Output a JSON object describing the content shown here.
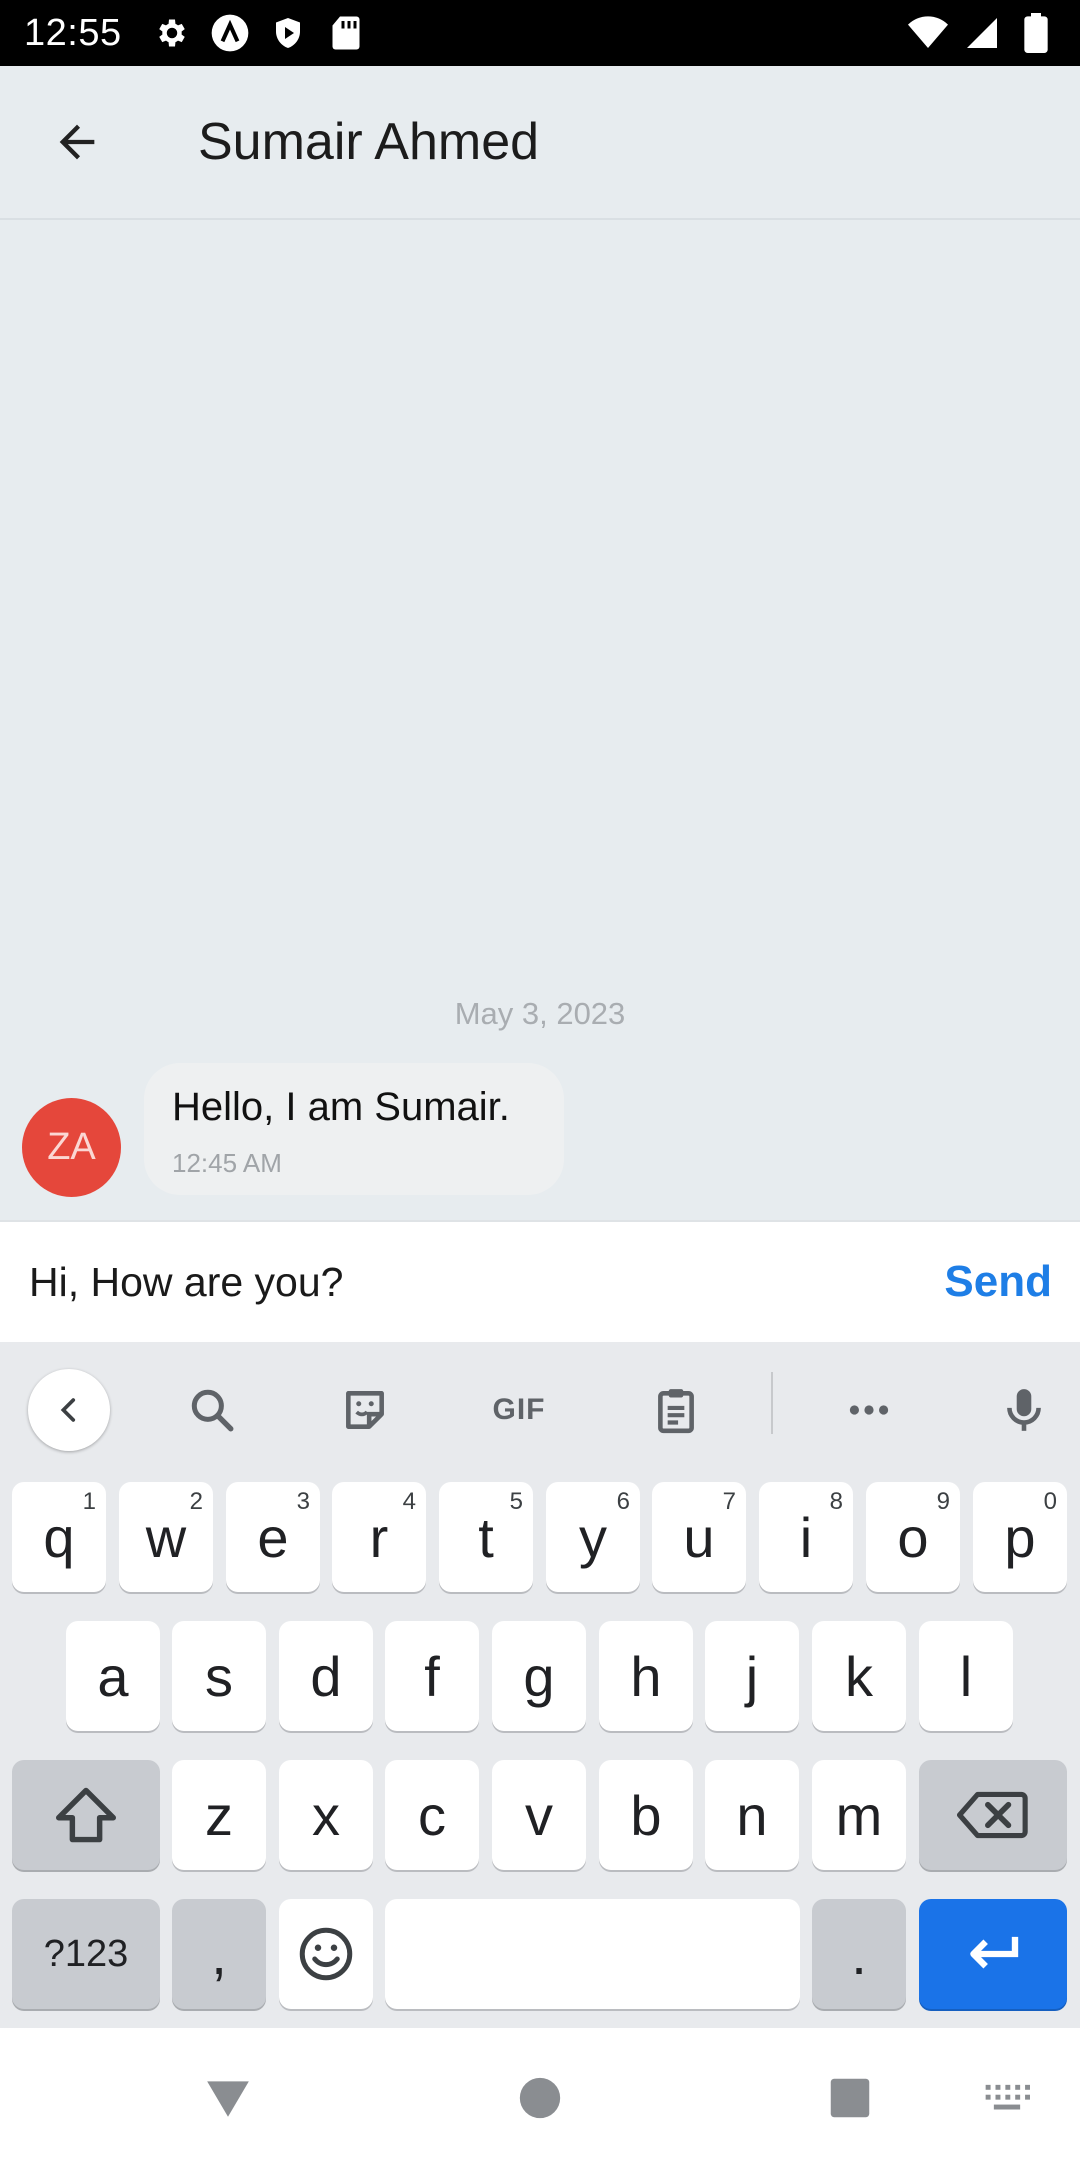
{
  "status_bar": {
    "time": "12:55",
    "left_icons": [
      "gear-icon",
      "a-circle-icon",
      "shield-play-icon",
      "sd-card-icon"
    ],
    "right_icons": [
      "wifi-icon",
      "signal-icon",
      "battery-icon"
    ]
  },
  "header": {
    "title": "Sumair Ahmed"
  },
  "chat": {
    "date_separator": "May 3, 2023",
    "messages": [
      {
        "avatar_initials": "ZA",
        "avatar_color": "#e5473b",
        "text": "Hello, I am Sumair.",
        "time": "12:45 AM"
      }
    ]
  },
  "composer": {
    "value": "Hi, How are you?",
    "send_label": "Send",
    "accent_color": "#1e7ee6"
  },
  "keyboard": {
    "toolbar": {
      "gif_label": "GIF",
      "tools": [
        "collapse-icon",
        "search-icon",
        "sticker-icon",
        "gif-icon",
        "clipboard-icon",
        "more-icon",
        "mic-icon"
      ]
    },
    "row1": [
      {
        "key": "q",
        "hint": "1"
      },
      {
        "key": "w",
        "hint": "2"
      },
      {
        "key": "e",
        "hint": "3"
      },
      {
        "key": "r",
        "hint": "4"
      },
      {
        "key": "t",
        "hint": "5"
      },
      {
        "key": "y",
        "hint": "6"
      },
      {
        "key": "u",
        "hint": "7"
      },
      {
        "key": "i",
        "hint": "8"
      },
      {
        "key": "o",
        "hint": "9"
      },
      {
        "key": "p",
        "hint": "0"
      }
    ],
    "row2": [
      "a",
      "s",
      "d",
      "f",
      "g",
      "h",
      "j",
      "k",
      "l"
    ],
    "row3": [
      "z",
      "x",
      "c",
      "v",
      "b",
      "n",
      "m"
    ],
    "row4": {
      "symbols_label": "?123",
      "comma": ",",
      "period": "."
    }
  },
  "nav_bar": {
    "buttons": [
      "back-triangle-icon",
      "home-circle-icon",
      "recents-square-icon",
      "keyboard-switch-icon"
    ]
  }
}
